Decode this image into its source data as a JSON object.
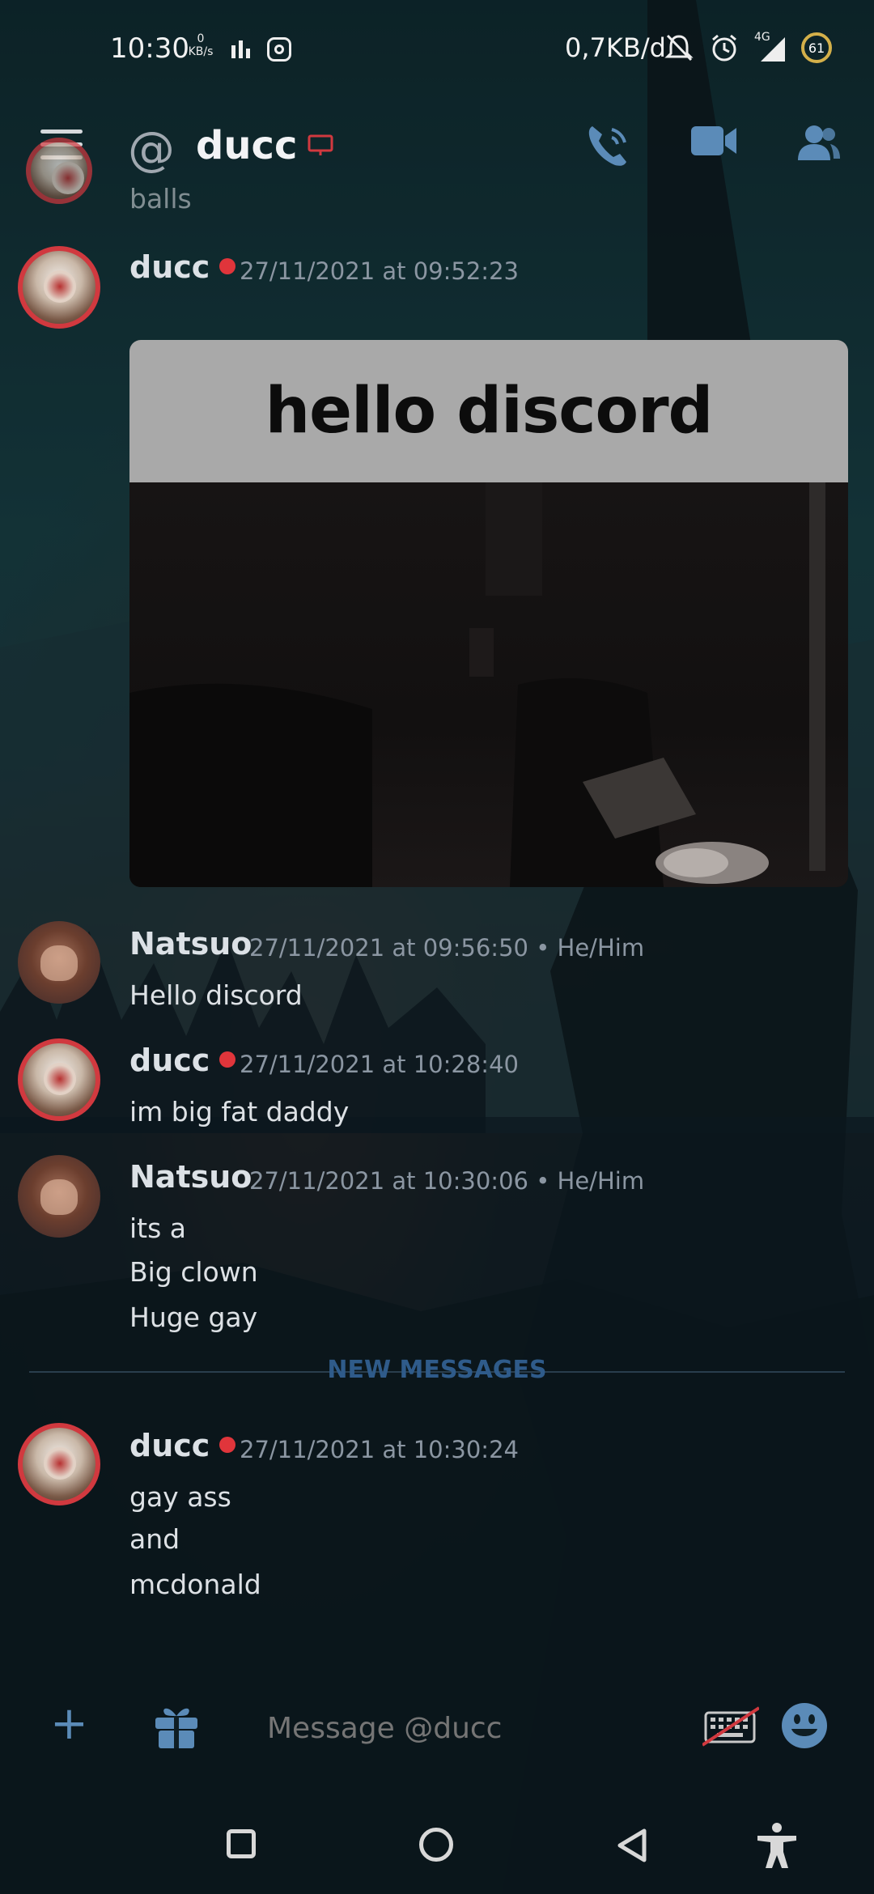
{
  "status_bar": {
    "time": "10:30",
    "kbs_value": "0",
    "kbs_unit": "KB/s",
    "data_usage": "0,7KB/d",
    "network_label": "4G",
    "battery": "61"
  },
  "header": {
    "at_symbol": "@",
    "title": "ducc",
    "icons": [
      "menu-icon",
      "screen-icon",
      "call-icon",
      "video-icon",
      "members-icon"
    ]
  },
  "messages": [
    {
      "id": "partial",
      "text": "balls"
    },
    {
      "author": "ducc",
      "status": "dnd",
      "timestamp": "27/11/2021 at 09:52:23",
      "embed_caption": "hello discord"
    },
    {
      "author": "Natsuo",
      "timestamp": "27/11/2021 at 09:56:50",
      "pronouns": "He/Him",
      "lines": [
        "Hello discord"
      ]
    },
    {
      "author": "ducc",
      "status": "dnd",
      "timestamp": "27/11/2021 at 10:28:40",
      "lines": [
        "im big fat daddy"
      ]
    },
    {
      "author": "Natsuo",
      "timestamp": "27/11/2021 at 10:30:06",
      "pronouns": "He/Him",
      "lines": [
        "its a",
        "Big clown",
        "Huge gay"
      ]
    },
    {
      "author": "ducc",
      "status": "dnd",
      "timestamp": "27/11/2021 at 10:30:24",
      "lines": [
        "gay ass",
        "and",
        "mcdonald"
      ]
    }
  ],
  "divider": {
    "label": "NEW MESSAGES"
  },
  "input": {
    "placeholder": "Message @ducc"
  },
  "colors": {
    "dnd": "#e0353b",
    "accent": "#5b8bb8",
    "divider": "#2f5b8a"
  }
}
